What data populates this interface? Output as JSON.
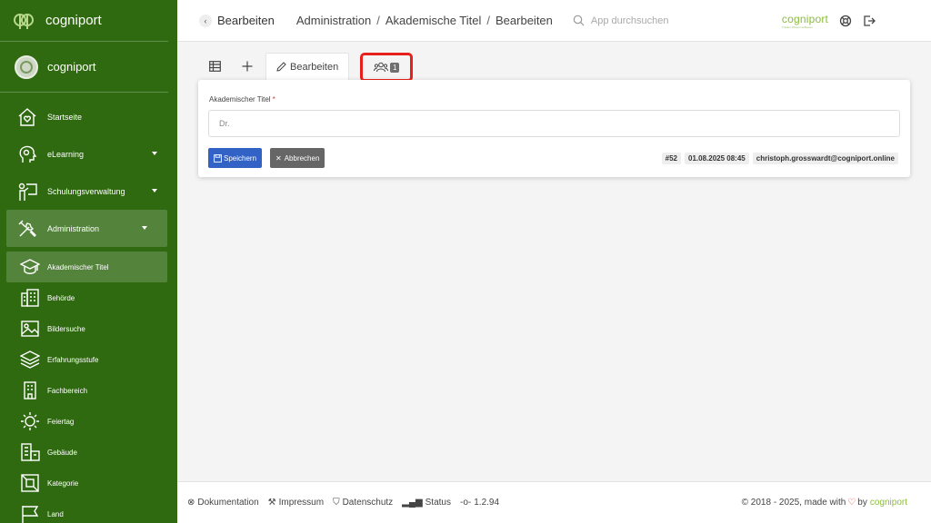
{
  "sidebar": {
    "brand": "cogniport",
    "org": "cogniport",
    "items": [
      {
        "label": "Startseite"
      },
      {
        "label": "eLearning"
      },
      {
        "label": "Schulungsverwaltung"
      },
      {
        "label": "Administration"
      }
    ],
    "sub_items": [
      {
        "label": "Akademischer Titel"
      },
      {
        "label": "Behörde"
      },
      {
        "label": "Bildersuche"
      },
      {
        "label": "Erfahrungsstufe"
      },
      {
        "label": "Fachbereich"
      },
      {
        "label": "Feiertag"
      },
      {
        "label": "Gebäude"
      },
      {
        "label": "Kategorie"
      },
      {
        "label": "Land"
      }
    ]
  },
  "header": {
    "back_label": "Bearbeiten",
    "crumbs": [
      "Administration",
      "Akademische Titel",
      "Bearbeiten"
    ],
    "crumb_sep": "/",
    "search_placeholder": "App durchsuchen",
    "brand": "cogniport",
    "brand_tagline": "Tracker Wissen aufbauen"
  },
  "tabs": {
    "edit_label": "Bearbeiten",
    "users_count": "1"
  },
  "form": {
    "field_label": "Akademischer Titel",
    "required_mark": "*",
    "field_value": "Dr.",
    "save_label": "Speichern",
    "cancel_label": "Abbrechen",
    "meta_id": "#52",
    "meta_date": "01.08.2025 08:45",
    "meta_user": "christoph.grosswardt@cogniport.online"
  },
  "footer": {
    "links": [
      "Dokumentation",
      "Impressum",
      "Datenschutz",
      "Status",
      "1.2.94"
    ],
    "copyright": "© 2018 - 2025, made with",
    "by": "by",
    "brand": "cogniport"
  },
  "colors": {
    "sidebar": "#2f6a10",
    "primary": "#3362c6",
    "highlight": "#e8201b",
    "brand_green": "#8bbd3c"
  }
}
